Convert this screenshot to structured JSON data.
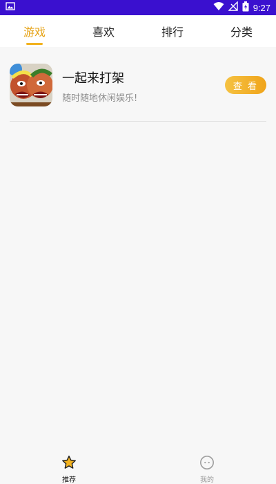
{
  "status_bar": {
    "time": "9:27",
    "icons": [
      "image-icon",
      "wifi-icon",
      "signal-icon",
      "battery-icon"
    ]
  },
  "tabs": [
    {
      "label": "游戏",
      "active": true
    },
    {
      "label": "喜欢",
      "active": false
    },
    {
      "label": "排行",
      "active": false
    },
    {
      "label": "分类",
      "active": false
    }
  ],
  "games": [
    {
      "name": "一起来打架",
      "description": "随时随地休闲娱乐!",
      "button_label": "查 看"
    }
  ],
  "bottom_nav": [
    {
      "label": "推荐",
      "icon": "star-icon",
      "active": true
    },
    {
      "label": "我的",
      "icon": "face-icon",
      "active": false
    }
  ],
  "colors": {
    "status_bar": "#3a10cf",
    "accent": "#f2b21f",
    "tab_active_text": "#e6a317"
  }
}
